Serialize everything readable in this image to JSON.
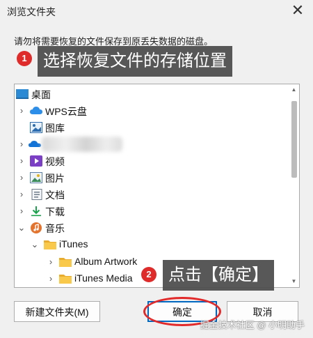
{
  "window": {
    "title": "浏览文件夹",
    "close_glyph": "✕"
  },
  "instruction": "请勿将需要恢复的文件保存到原丢失数据的磁盘。",
  "annotations": {
    "step1": {
      "number": "1",
      "text": "选择恢复文件的存储位置"
    },
    "step2": {
      "number": "2",
      "text": "点击【确定】"
    },
    "accent_color": "#e02b2b"
  },
  "tree": {
    "items": [
      {
        "label": "桌面",
        "icon": "desktop-icon",
        "expander": ""
      },
      {
        "label": "WPS云盘",
        "icon": "cloud-icon",
        "expander": "›"
      },
      {
        "label": "图库",
        "icon": "gallery-icon",
        "expander": ""
      },
      {
        "label": "",
        "icon": "onedrive-icon",
        "expander": "›"
      },
      {
        "label": "视频",
        "icon": "video-icon",
        "expander": "›"
      },
      {
        "label": "图片",
        "icon": "pictures-icon",
        "expander": "›"
      },
      {
        "label": "文档",
        "icon": "documents-icon",
        "expander": "›"
      },
      {
        "label": "下载",
        "icon": "download-icon",
        "expander": "›"
      },
      {
        "label": "音乐",
        "icon": "music-icon",
        "expander": "⌄"
      },
      {
        "label": "iTunes",
        "icon": "folder-icon",
        "expander": "⌄"
      },
      {
        "label": "Album Artwork",
        "icon": "folder-icon",
        "expander": "›"
      },
      {
        "label": "iTunes Media",
        "icon": "folder-icon",
        "expander": "›"
      }
    ]
  },
  "buttons": {
    "new_folder": "新建文件夹(M)",
    "ok": "确定",
    "cancel": "取消"
  },
  "watermark": "掘金技术社区 @ 小明助手"
}
